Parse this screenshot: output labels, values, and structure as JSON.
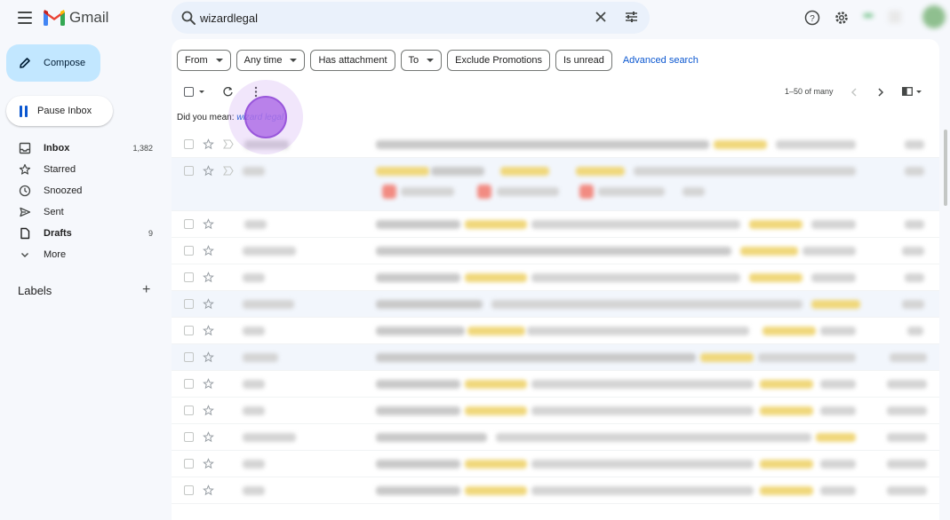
{
  "app": {
    "name": "Gmail"
  },
  "search": {
    "query": "wizardlegal"
  },
  "sidebar": {
    "compose_label": "Compose",
    "pause_label": "Pause Inbox",
    "items": [
      {
        "label": "Inbox",
        "count": "1,382",
        "icon": "inbox-icon",
        "bold": true
      },
      {
        "label": "Starred",
        "count": "",
        "icon": "star-icon",
        "bold": false
      },
      {
        "label": "Snoozed",
        "count": "",
        "icon": "clock-icon",
        "bold": false
      },
      {
        "label": "Sent",
        "count": "",
        "icon": "send-icon",
        "bold": false
      },
      {
        "label": "Drafts",
        "count": "9",
        "icon": "file-icon",
        "bold": true
      },
      {
        "label": "More",
        "count": "",
        "icon": "chevron-down-icon",
        "bold": false
      }
    ],
    "labels_heading": "Labels"
  },
  "filters": {
    "chips": [
      {
        "label": "From",
        "dropdown": true
      },
      {
        "label": "Any time",
        "dropdown": true
      },
      {
        "label": "Has attachment",
        "dropdown": false
      },
      {
        "label": "To",
        "dropdown": true
      },
      {
        "label": "Exclude Promotions",
        "dropdown": false
      },
      {
        "label": "Is unread",
        "dropdown": false
      }
    ],
    "advanced_search": "Advanced search"
  },
  "toolbar": {
    "pagination": "1–50 of many"
  },
  "did_you_mean": {
    "prefix": "Did you mean:",
    "suggestion": "wizard legal"
  },
  "colors": {
    "accent": "#0b57d0",
    "compose_bg": "#c2e7ff",
    "cursor": "#b070e8"
  }
}
